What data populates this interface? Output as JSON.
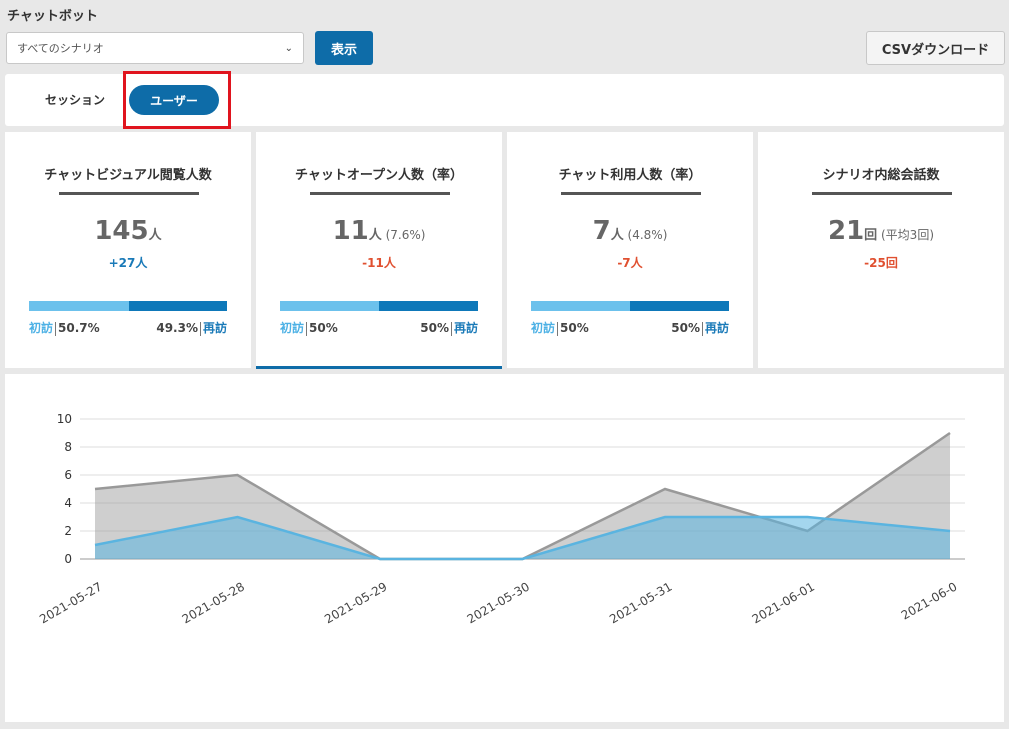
{
  "header": {
    "title": "チャットボット",
    "scenario_selected": "すべてのシナリオ",
    "show_label": "表示",
    "csv_label": "CSVダウンロード"
  },
  "tabs": {
    "session": "セッション",
    "user": "ユーザー"
  },
  "cards": [
    {
      "title": "チャットビジュアル閲覧人数",
      "value": "145",
      "unit": "人",
      "sub": "",
      "delta": "+27人",
      "delta_dir": "up",
      "new_label": "初訪",
      "new_pct": "50.7%",
      "ret_pct": "49.3%",
      "ret_label": "再訪",
      "new_ratio": 0.507
    },
    {
      "title": "チャットオープン人数（率）",
      "value": "11",
      "unit": "人",
      "sub": " (7.6%)",
      "delta": "-11人",
      "delta_dir": "down",
      "new_label": "初訪",
      "new_pct": "50%",
      "ret_pct": "50%",
      "ret_label": "再訪",
      "new_ratio": 0.5
    },
    {
      "title": "チャット利用人数（率）",
      "value": "7",
      "unit": "人",
      "sub": " (4.8%)",
      "delta": "-7人",
      "delta_dir": "down",
      "new_label": "初訪",
      "new_pct": "50%",
      "ret_pct": "50%",
      "ret_label": "再訪",
      "new_ratio": 0.5
    },
    {
      "title": "シナリオ内総会話数",
      "value": "21",
      "unit": "回",
      "sub": " (平均3回)",
      "delta": "-25回",
      "delta_dir": "down"
    }
  ],
  "colors": {
    "accent": "#0e6ca8",
    "series_gray": "#999999",
    "series_blue": "#5ab4e0"
  },
  "chart_data": {
    "type": "area",
    "x": [
      "2021-05-27",
      "2021-05-28",
      "2021-05-29",
      "2021-05-30",
      "2021-05-31",
      "2021-06-01",
      "2021-06-0"
    ],
    "series": [
      {
        "values": [
          5,
          6,
          0,
          0,
          5,
          2,
          9
        ]
      },
      {
        "values": [
          1,
          3,
          0,
          0,
          3,
          3,
          2
        ]
      }
    ],
    "ylim": [
      0,
      10
    ],
    "yticks": [
      "0",
      "2",
      "4",
      "6",
      "8",
      "10"
    ],
    "grid": true
  }
}
